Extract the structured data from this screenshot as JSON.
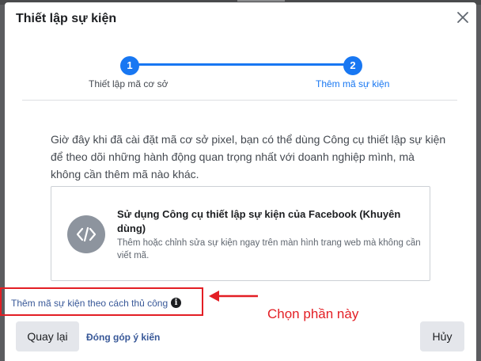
{
  "dialog": {
    "title": "Thiết lập sự kiện",
    "close_icon": "close-icon"
  },
  "steps": [
    {
      "number": "1",
      "label": "Thiết lập mã cơ sở",
      "state": "completed"
    },
    {
      "number": "2",
      "label": "Thêm mã sự kiện",
      "state": "active"
    }
  ],
  "description": "Giờ đây khi đã cài đặt mã cơ sở pixel, bạn có thể dùng Công cụ thiết lập sự kiện để theo dõi những hành động quan trọng nhất với doanh nghiệp mình, mà không cần thêm mã nào khác.",
  "option_card": {
    "icon": "code-icon",
    "title": "Sử dụng Công cụ thiết lập sự kiện của Facebook (Khuyên dùng)",
    "subtitle": "Thêm hoặc chỉnh sửa sự kiện ngay trên màn hình trang web mà không cần viết mã."
  },
  "manual_link": {
    "label": "Thêm mã sự kiện theo cách thủ công",
    "icon": "info-icon",
    "info_glyph": "i"
  },
  "annotation": {
    "text": "Chọn phần này",
    "color": "#e31e24"
  },
  "footer": {
    "back_label": "Quay lại",
    "feedback_label": "Đóng góp ý kiến",
    "cancel_label": "Hủy"
  },
  "colors": {
    "accent": "#1877f2",
    "link": "#385898",
    "annotation": "#e31e24"
  }
}
